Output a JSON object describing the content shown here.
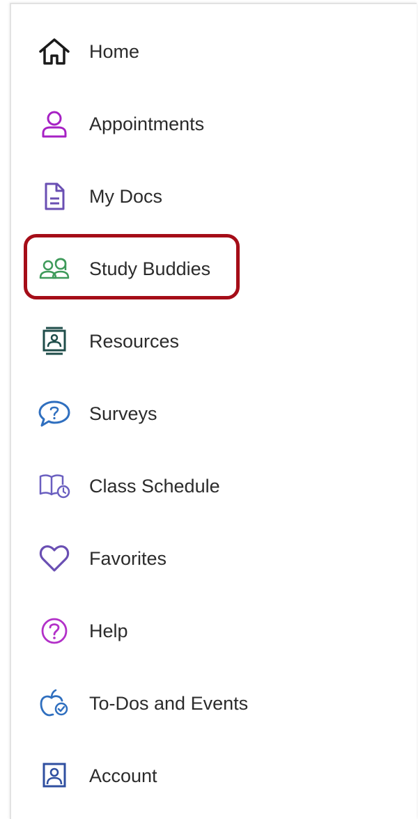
{
  "nav": {
    "items": [
      {
        "label": "Home",
        "icon": "home-icon",
        "color": "#1a1a1a"
      },
      {
        "label": "Appointments",
        "icon": "person-icon",
        "color": "#a621c4"
      },
      {
        "label": "My Docs",
        "icon": "document-icon",
        "color": "#6a4fb3"
      },
      {
        "label": "Study Buddies",
        "icon": "people-icon",
        "color": "#3e9a5a"
      },
      {
        "label": "Resources",
        "icon": "contact-card-icon",
        "color": "#1f4d4a"
      },
      {
        "label": "Surveys",
        "icon": "question-bubble-icon",
        "color": "#2f6fbf"
      },
      {
        "label": "Class Schedule",
        "icon": "book-clock-icon",
        "color": "#6a5fc0"
      },
      {
        "label": "Favorites",
        "icon": "heart-icon",
        "color": "#6a4fb3"
      },
      {
        "label": "Help",
        "icon": "help-circle-icon",
        "color": "#b230c8"
      },
      {
        "label": "To-Dos and Events",
        "icon": "apple-check-icon",
        "color": "#2f6fbf"
      },
      {
        "label": "Account",
        "icon": "account-icon",
        "color": "#2f4fa0"
      }
    ],
    "highlighted": "Study Buddies",
    "highlight_color": "#a50d18"
  }
}
